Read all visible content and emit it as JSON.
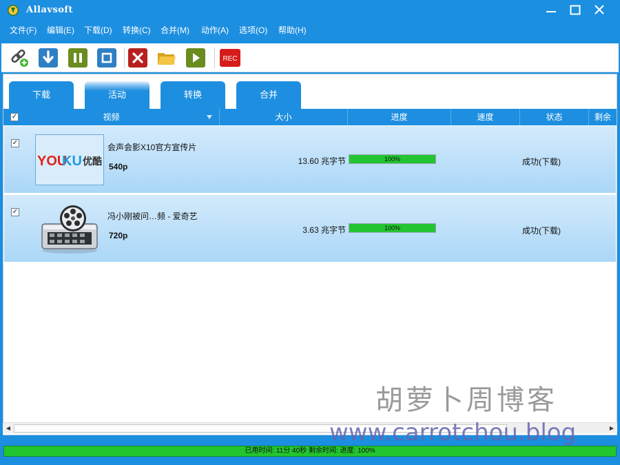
{
  "window": {
    "title": "Allavsoft"
  },
  "menu": [
    "文件(F)",
    "编辑(E)",
    "下载(D)",
    "转换(C)",
    "合并(M)",
    "动作(A)",
    "选项(O)",
    "帮助(H)"
  ],
  "toolbar": {
    "rec_label": "REC"
  },
  "tabs": [
    {
      "label": "下载",
      "active": false
    },
    {
      "label": "活动",
      "active": true
    },
    {
      "label": "转换",
      "active": false
    },
    {
      "label": "合并",
      "active": false
    }
  ],
  "columns": {
    "video": "视频",
    "size": "大小",
    "progress": "进度",
    "speed": "速度",
    "status": "状态",
    "remaining": "剩余"
  },
  "rows": [
    {
      "title": "会声会影X10官方宣传片",
      "resolution": "540p",
      "size": "13.60 兆字节",
      "progress_label": "100%",
      "progress": 1.0,
      "status": "成功(下载)",
      "thumb": "youku-logo",
      "logo_you": "YOU",
      "logo_ku": "KU",
      "logo_cn": "优酷"
    },
    {
      "title": "冯小刚被问…频 - 爱奇艺",
      "resolution": "720p",
      "size": "3.63 兆字节",
      "progress_label": "100%",
      "progress": 1.0,
      "status": "成功(下载)",
      "thumb": "film-reel-icon"
    }
  ],
  "statusbar": {
    "text": "已用时间: 11分 40秒 剩余时间:  进度: 100%",
    "progress": 1.0
  },
  "watermark": {
    "cn": "胡萝卜周博客",
    "url": "www.carrotchou.blog"
  },
  "colors": {
    "accent": "#1e8fe0",
    "progress": "#22c52f"
  }
}
